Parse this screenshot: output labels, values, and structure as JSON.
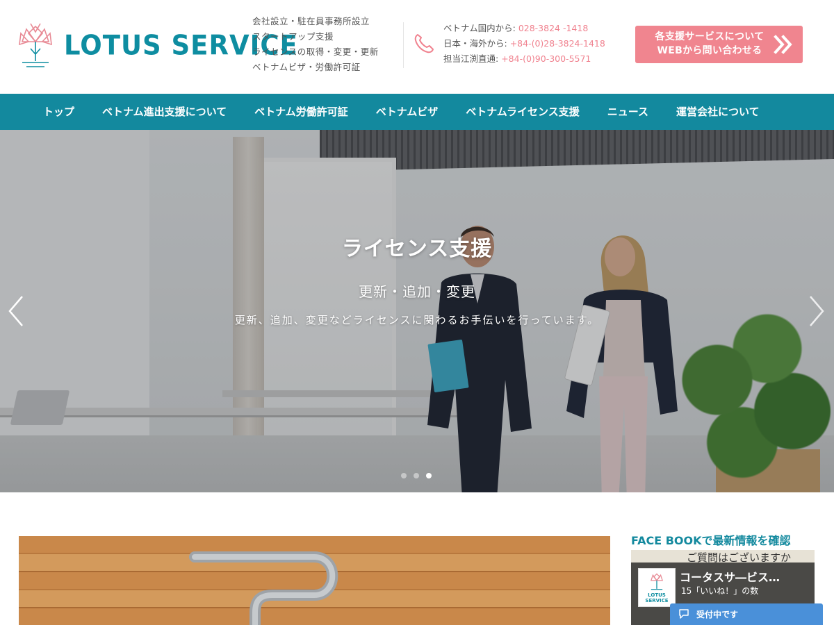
{
  "header": {
    "logo_text": "LOTUS SERVICE",
    "services": [
      "会社設立・駐在員事務所設立",
      "スタートアップ支援",
      "ライセンスの取得・変更・更新",
      "ベトナムビザ・労働許可証"
    ],
    "phones": [
      {
        "label": "ベトナム国内から: ",
        "number": "028-3824 -1418"
      },
      {
        "label": "日本・海外から: ",
        "number": "+84-(0)28-3824-1418"
      },
      {
        "label": "担当江渕直通: ",
        "number": "+84-(0)90-300-5571"
      }
    ],
    "cta": {
      "line1": "各支援サービスについて",
      "line2": "WEBから問い合わせる"
    }
  },
  "nav": {
    "items": [
      "トップ",
      "ベトナム進出支援について",
      "ベトナム労働許可証",
      "ベトナムビザ",
      "ベトナムライセンス支援",
      "ニュース",
      "運営会社について"
    ]
  },
  "hero": {
    "title": "ライセンス支援",
    "subtitle": "更新・追加・変更",
    "description": "更新、追加、変更などライセンスに関わるお手伝いを行っています。",
    "slide_count": 3,
    "active_slide": 3
  },
  "sidebar": {
    "facebook_title": "FACE BOOKで最新情報を確認",
    "fb_page_name": "コータスサ―ビス…",
    "fb_likes": "15「いいね！」の数",
    "fb_bg_text": "ご質問はございますか"
  },
  "chat": {
    "label": "受付中です"
  },
  "colors": {
    "brand": "#13899e",
    "accent": "#f0858f",
    "logo_pink": "#e88a95"
  }
}
